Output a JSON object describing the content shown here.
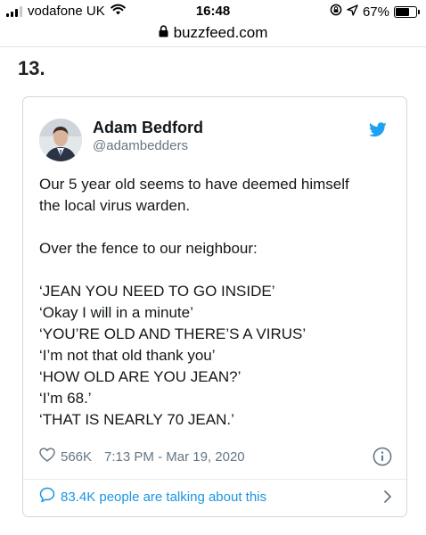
{
  "status_bar": {
    "carrier": "vodafone UK",
    "time": "16:48",
    "battery": "67%",
    "battery_level": 0.67
  },
  "url_bar": {
    "domain": "buzzfeed.com"
  },
  "list_number": "13.",
  "tweet": {
    "author_name": "Adam Bedford",
    "author_handle": "@adambedders",
    "lines": [
      "Our 5 year old seems to have deemed himself",
      "the local virus warden.",
      "",
      "Over the fence to our neighbour:",
      "",
      "‘JEAN YOU NEED TO GO INSIDE’",
      "‘Okay I will in a minute’",
      "‘YOU’RE OLD AND THERE’S A VIRUS’",
      "‘I’m not that old thank you’",
      "‘HOW OLD ARE YOU JEAN?’",
      "‘I’m 68.’",
      "‘THAT IS NEARLY 70 JEAN.’"
    ],
    "likes": "566K",
    "timestamp": "7:13 PM - Mar 19, 2020",
    "talking_about": "83.4K people are talking about this"
  },
  "colors": {
    "twitter_blue": "#1da1f2",
    "link_blue": "#1b95e0",
    "muted_text": "#657786",
    "card_border": "#cfd9de"
  },
  "icons": {
    "signal": "signal-bars-icon",
    "wifi": "wifi-icon",
    "rotation_lock": "rotation-lock-icon",
    "location": "location-arrow-icon",
    "battery": "battery-icon",
    "lock": "lock-icon",
    "twitter": "twitter-bird-icon",
    "heart": "heart-icon",
    "info": "info-icon",
    "bubble": "speech-bubble-icon",
    "chevron": "chevron-right-icon"
  }
}
